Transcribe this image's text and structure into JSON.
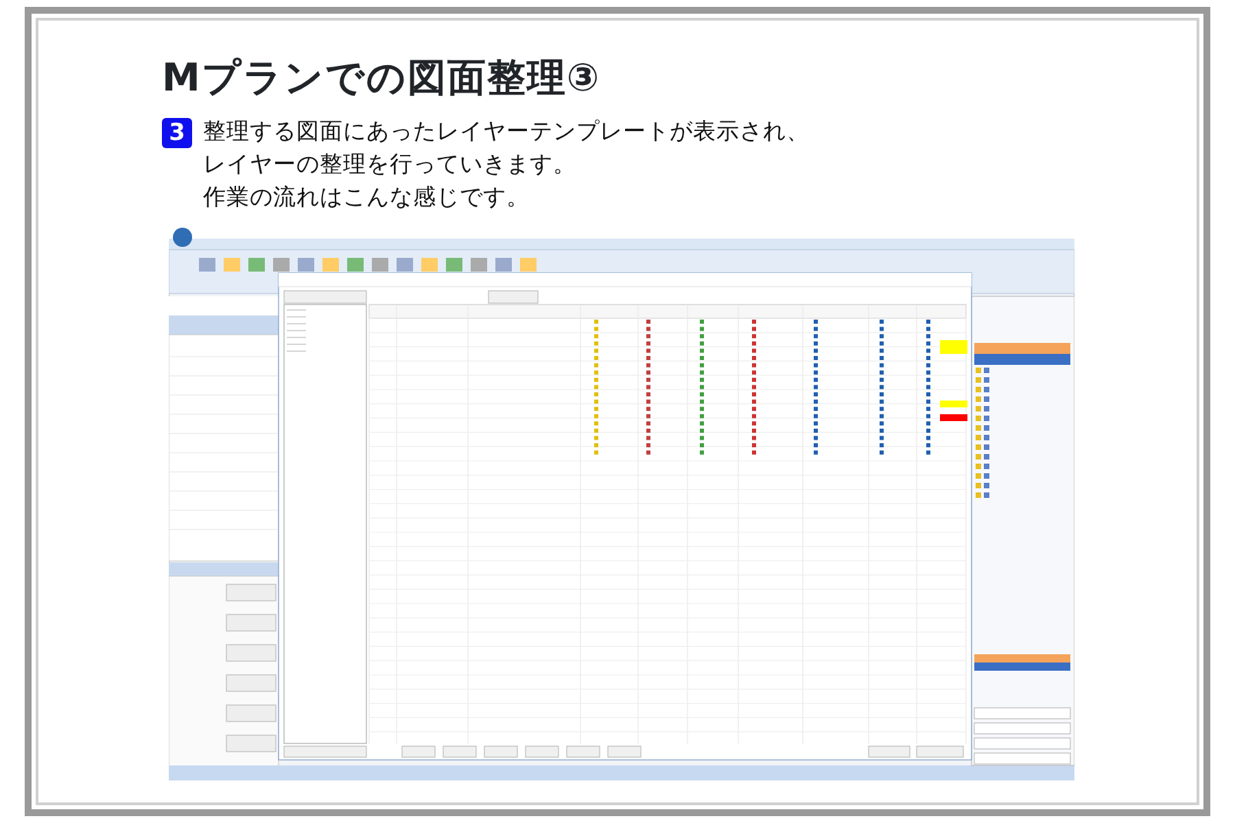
{
  "slide": {
    "title": "Mプランでの図面整理③",
    "step": {
      "number": "3",
      "lines": [
        "整理する図面にあったレイヤーテンプレートが表示され、",
        "レイヤーの整理を行っていきます。",
        "作業の流れはこんな感じです。"
      ]
    }
  }
}
